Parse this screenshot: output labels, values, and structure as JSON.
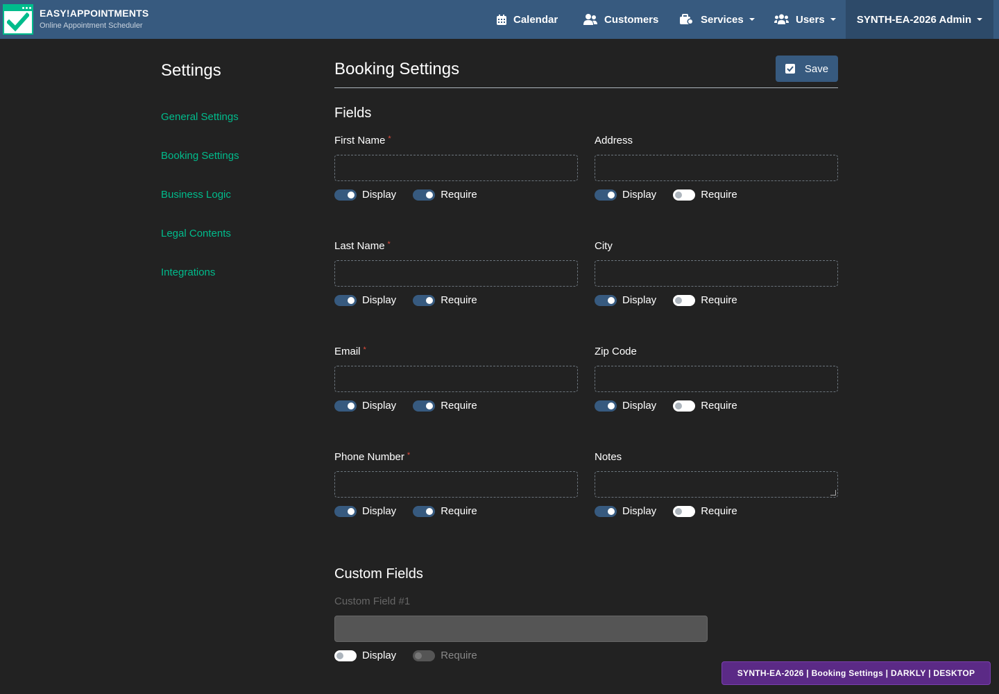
{
  "brand": {
    "title": "EASY!APPOINTMENTS",
    "subtitle": "Online Appointment Scheduler",
    "accent": "#00bc8c",
    "header_color": "#375a7f"
  },
  "nav": {
    "calendar": "Calendar",
    "customers": "Customers",
    "services": "Services",
    "users": "Users",
    "admin": "SYNTH-EA-2026 Admin"
  },
  "sidebar": {
    "title": "Settings",
    "items": [
      {
        "label": "General Settings"
      },
      {
        "label": "Booking Settings"
      },
      {
        "label": "Business Logic"
      },
      {
        "label": "Legal Contents"
      },
      {
        "label": "Integrations"
      }
    ]
  },
  "page": {
    "title": "Booking Settings",
    "save_label": "Save"
  },
  "fields_section": {
    "title": "Fields",
    "display_label": "Display",
    "require_label": "Require",
    "required_mark": "*",
    "fields": [
      {
        "label": "First Name",
        "required": true,
        "display": true,
        "require": true
      },
      {
        "label": "Address",
        "required": false,
        "display": true,
        "require": false
      },
      {
        "label": "Last Name",
        "required": true,
        "display": true,
        "require": true
      },
      {
        "label": "City",
        "required": false,
        "display": true,
        "require": false
      },
      {
        "label": "Email",
        "required": true,
        "display": true,
        "require": true
      },
      {
        "label": "Zip Code",
        "required": false,
        "display": true,
        "require": false
      },
      {
        "label": "Phone Number",
        "required": true,
        "display": true,
        "require": true
      },
      {
        "label": "Notes",
        "required": false,
        "display": true,
        "require": false
      }
    ]
  },
  "custom_section": {
    "title": "Custom Fields",
    "field_label": "Custom Field #1",
    "display": false,
    "require": false
  },
  "badge": "SYNTH-EA-2026 | Booking Settings | DARKLY | DESKTOP"
}
